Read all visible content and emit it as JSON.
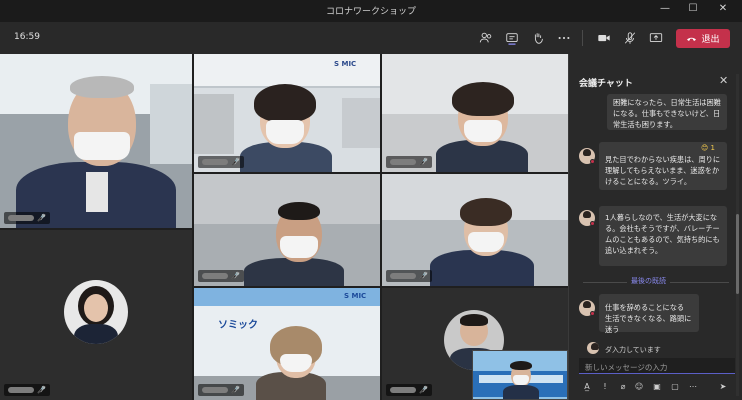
{
  "window": {
    "title": "コロナワークショップ",
    "controls": {
      "minimize": "—",
      "maximize": "☐",
      "close": "✕"
    }
  },
  "toolbar": {
    "clock": "16:59",
    "leave_label": "退出",
    "colors": {
      "leave": "#c4314b",
      "accent": "#5b5fc7"
    },
    "icons": [
      "participants-icon",
      "chat-icon",
      "raise-hand-icon",
      "more-icon",
      "camera-icon",
      "mic-off-icon",
      "share-icon",
      "phone-icon"
    ]
  },
  "stage": {
    "tiles": [
      {
        "id": "p1",
        "mic": "muted"
      },
      {
        "id": "p2",
        "mic": "muted"
      },
      {
        "id": "p3",
        "mic": "muted"
      },
      {
        "id": "p4",
        "mic": "muted"
      },
      {
        "id": "p5",
        "mic": "muted"
      },
      {
        "id": "p6",
        "mic": "muted"
      },
      {
        "id": "p7",
        "mic": "muted"
      },
      {
        "id": "p8",
        "mic": "muted"
      },
      {
        "id": "p9",
        "mic": "muted"
      }
    ],
    "signs": {
      "somic_top": "S MIC",
      "somic_bottom": "S MIC",
      "building_sign": "ソミック"
    }
  },
  "chat": {
    "title": "会議チャット",
    "messages": [
      {
        "text": "困難になったら、日常生活は困難になる。仕事もできないけど、日常生活も困ります。",
        "reaction": "😊"
      },
      {
        "text": "見た目でわからない疾患は、周りに理解してもらえないまま、迷惑をかけることになる。ツライ。",
        "reaction": "😊 1"
      },
      {
        "text": "1人暮らしなので、生活が大変になる。会社もそうですが、バレーチームのこともあるので、気持ち的にも追い込まれそう。"
      },
      {
        "text": "仕事を辞めることになる\n生活できなくなる、路頭に迷う"
      }
    ],
    "divider_label": "最後の既読",
    "typing": "ダ入力しています",
    "compose_placeholder": "新しいメッセージの入力",
    "compose_icons": [
      "format-icon",
      "important-icon",
      "attach-icon",
      "emoji-icon",
      "gif-icon",
      "sticker-icon",
      "more-icon",
      "send-icon"
    ]
  }
}
